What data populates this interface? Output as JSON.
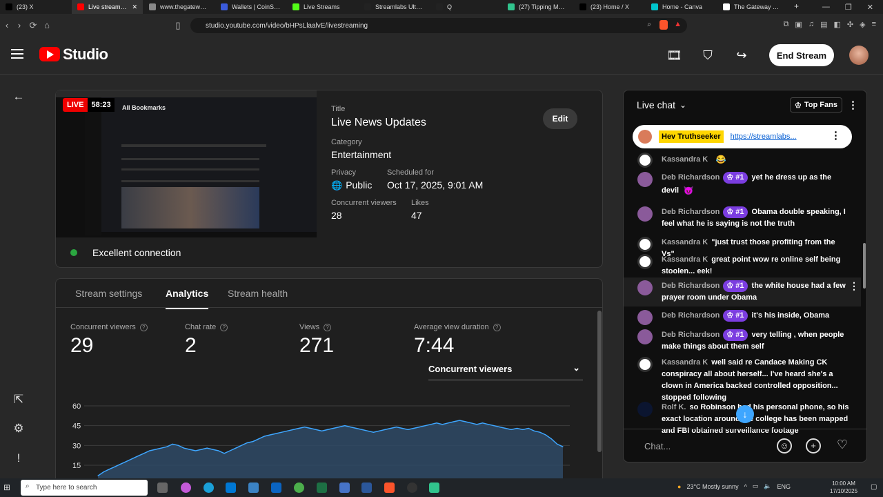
{
  "browser": {
    "tabs": [
      {
        "label": "(23) X",
        "color": "#000000"
      },
      {
        "label": "Live streaming",
        "color": "#ff0000",
        "active": true
      },
      {
        "label": "www.thegatewaypu",
        "color": "#888888"
      },
      {
        "label": "Wallets | CoinSpot",
        "color": "#3b5bdb"
      },
      {
        "label": "Live Streams",
        "color": "#53fc18"
      },
      {
        "label": "Streamlabs Ultra | V",
        "color": "#222222"
      },
      {
        "label": "Q",
        "color": "#222222"
      },
      {
        "label": "(27) Tipping Metho",
        "color": "#31c48d"
      },
      {
        "label": "(23) Home / X",
        "color": "#000000"
      },
      {
        "label": "Home - Canva",
        "color": "#00c4cc"
      },
      {
        "label": "The Gateway Pundit",
        "color": "#ffffff"
      }
    ],
    "url": "studio.youtube.com/video/bHPsLlaalvE/livestreaming"
  },
  "header": {
    "product": "Studio",
    "end_stream_label": "End Stream"
  },
  "preview": {
    "live_label": "LIVE",
    "elapsed": "58:23",
    "inner_title": "All Bookmarks"
  },
  "details": {
    "title_label": "Title",
    "title": "Live News Updates",
    "category_label": "Category",
    "category": "Entertainment",
    "privacy_label": "Privacy",
    "privacy": "Public",
    "scheduled_label": "Scheduled for",
    "scheduled": "Oct 17, 2025, 9:01 AM",
    "concurrent_label": "Concurrent viewers",
    "concurrent": "28",
    "likes_label": "Likes",
    "likes": "47",
    "edit_label": "Edit"
  },
  "connection": {
    "status": "Excellent connection",
    "color": "#2ba640"
  },
  "analytics_tabs": [
    {
      "label": "Stream settings"
    },
    {
      "label": "Analytics",
      "active": true
    },
    {
      "label": "Stream health"
    }
  ],
  "stats": [
    {
      "label": "Concurrent viewers",
      "value": "29"
    },
    {
      "label": "Chat rate",
      "value": "2"
    },
    {
      "label": "Views",
      "value": "271"
    },
    {
      "label": "Average view duration",
      "value": "7:44"
    }
  ],
  "metric_select": "Concurrent viewers",
  "chart_data": {
    "type": "area",
    "y_ticks": [
      "60",
      "45",
      "30",
      "15"
    ],
    "ylim": [
      0,
      60
    ],
    "values": [
      7,
      10,
      12,
      14,
      16,
      18,
      20,
      22,
      24,
      26,
      27,
      28,
      29,
      31,
      30,
      28,
      27,
      26,
      27,
      28,
      27,
      26,
      24,
      26,
      28,
      30,
      32,
      33,
      35,
      37,
      38,
      39,
      40,
      41,
      42,
      43,
      44,
      43,
      42,
      41,
      42,
      43,
      44,
      45,
      44,
      43,
      42,
      41,
      40,
      41,
      42,
      43,
      44,
      43,
      42,
      43,
      44,
      45,
      46,
      47,
      46,
      47,
      48,
      49,
      48,
      47,
      46,
      47,
      46,
      45,
      44,
      43,
      42,
      43,
      42,
      43,
      41,
      40,
      38,
      35,
      31,
      29
    ],
    "color": "#3ea6ff"
  },
  "chat": {
    "title": "Live chat",
    "top_fans": "Top Fans",
    "pinned": {
      "name": "Hev Truthseeker",
      "link": "https://streamlabs..."
    },
    "messages": [
      {
        "name": "Kassandra K",
        "text": "",
        "emoji": "😂",
        "type": "k"
      },
      {
        "name": "Deb Richardson",
        "badge": "#1",
        "text": "yet he dress up as the devil",
        "emoji": "😈",
        "type": "d"
      },
      {
        "name": "Deb Richardson",
        "badge": "#1",
        "text": "Obama double speaking, I feel what he is saying is not the truth",
        "type": "d"
      },
      {
        "name": "Kassandra K",
        "text": "\"just trust those profiting from the Vs\"",
        "type": "k"
      },
      {
        "name": "Kassandra K",
        "text": "great point wow re online self being stoolen... eek!",
        "type": "k"
      },
      {
        "name": "Deb Richardson",
        "badge": "#1",
        "text": "the white house had a few prayer room under Obama",
        "type": "d",
        "highlight": true
      },
      {
        "name": "Deb Richardson",
        "badge": "#1",
        "text": "it's his inside, Obama",
        "type": "d"
      },
      {
        "name": "Deb Richardson",
        "badge": "#1",
        "text": "very telling , when people make things about them self",
        "type": "d"
      },
      {
        "name": "Kassandra K",
        "text": "well said re Candace Making CK conspiracy all about herself... I've heard she's a clown in America backed controlled opposition... stopped following",
        "type": "k"
      },
      {
        "name": "Rolf K.",
        "text": "so Robinson had his personal phone, so his exact location around the college has been mapped and FBI obtained surveillance footage",
        "type": "r"
      }
    ],
    "input_placeholder": "Chat..."
  },
  "taskbar": {
    "search_placeholder": "Type here to search",
    "weather": "23°C  Mostly sunny",
    "lang": "ENG",
    "time": "10:00 AM",
    "date": "17/10/2025"
  }
}
